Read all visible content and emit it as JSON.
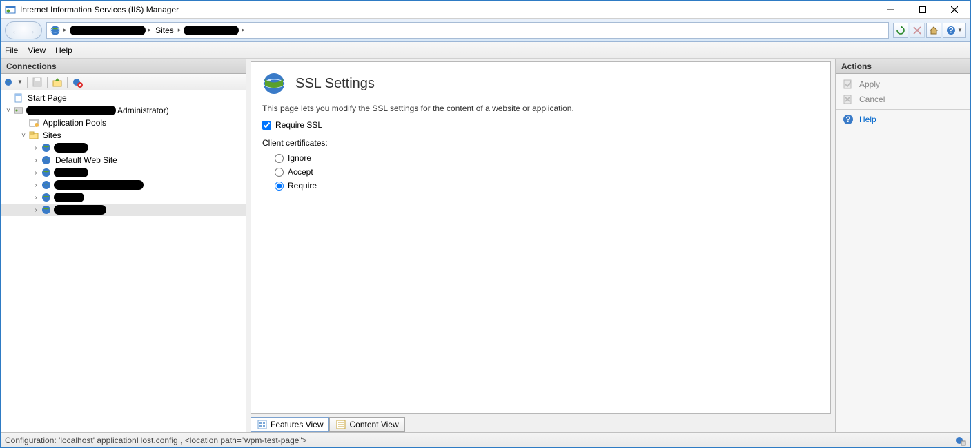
{
  "window": {
    "title": "Internet Information Services (IIS) Manager"
  },
  "menubar": {
    "items": [
      "File",
      "View",
      "Help"
    ]
  },
  "breadcrumb": {
    "host": "(redacted)",
    "sites_label": "Sites",
    "site": "(redacted)"
  },
  "connections": {
    "header": "Connections",
    "start_page": "Start Page",
    "server_suffix": "Administrator)",
    "app_pools": "Application Pools",
    "sites_label": "Sites",
    "default_site": "Default Web Site"
  },
  "center": {
    "title": "SSL Settings",
    "description": "This page lets you modify the SSL settings for the content of a website or application.",
    "require_ssl_label": "Require SSL",
    "require_ssl_checked": true,
    "client_cert_label": "Client certificates:",
    "radios": {
      "ignore": "Ignore",
      "accept": "Accept",
      "require": "Require"
    },
    "selected_radio": "require",
    "tabs": {
      "features": "Features View",
      "content": "Content View"
    }
  },
  "actions": {
    "header": "Actions",
    "apply": "Apply",
    "cancel": "Cancel",
    "help": "Help"
  },
  "status": {
    "text": "Configuration: 'localhost' applicationHost.config , <location path=\"wpm-test-page\">"
  }
}
